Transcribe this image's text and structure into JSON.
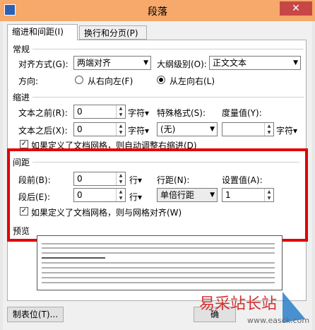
{
  "window": {
    "title": "段落",
    "close_label": "✕"
  },
  "tabs": [
    {
      "label": "缩进和间距(I)",
      "active": true
    },
    {
      "label": "换行和分页(P)",
      "active": false
    }
  ],
  "general": {
    "section_label": "常规",
    "alignment_label": "对齐方式(G):",
    "alignment_value": "两端对齐",
    "outline_label": "大纲级别(O):",
    "outline_value": "正文文本",
    "direction_label": "方向:",
    "rtl_label": "从右向左(F)",
    "ltr_label": "从左向右(L)"
  },
  "indent": {
    "section_label": "缩进",
    "before_label": "文本之前(R):",
    "before_value": "0",
    "before_unit": "字符▾",
    "after_label": "文本之后(X):",
    "after_value": "0",
    "after_unit": "字符▾",
    "special_label": "特殊格式(S):",
    "special_value": "(无)",
    "measure_label": "度量值(Y):",
    "measure_value": "",
    "measure_unit": "字符▾",
    "grid_checkbox_label": "如果定义了文档网格，则自动调整右缩进(D)"
  },
  "spacing": {
    "section_label": "间距",
    "before_label": "段前(B):",
    "before_value": "0",
    "before_unit": "行▾",
    "after_label": "段后(E):",
    "after_value": "0",
    "after_unit": "行▾",
    "line_label": "行距(N):",
    "line_value": "单倍行距",
    "setting_label": "设置值(A):",
    "setting_value": "1",
    "grid_checkbox_label": "如果定义了文档网格，则与网格对齐(W)"
  },
  "preview": {
    "section_label": "预览"
  },
  "footer": {
    "tabs_button": "制表位(T)...",
    "ok_button": "确"
  },
  "watermark": {
    "text": "易采站长站",
    "url": "www.easck.com"
  },
  "colors": {
    "titlebar": "#f6a96a",
    "highlight": "#e00000",
    "close": "#c74747"
  }
}
